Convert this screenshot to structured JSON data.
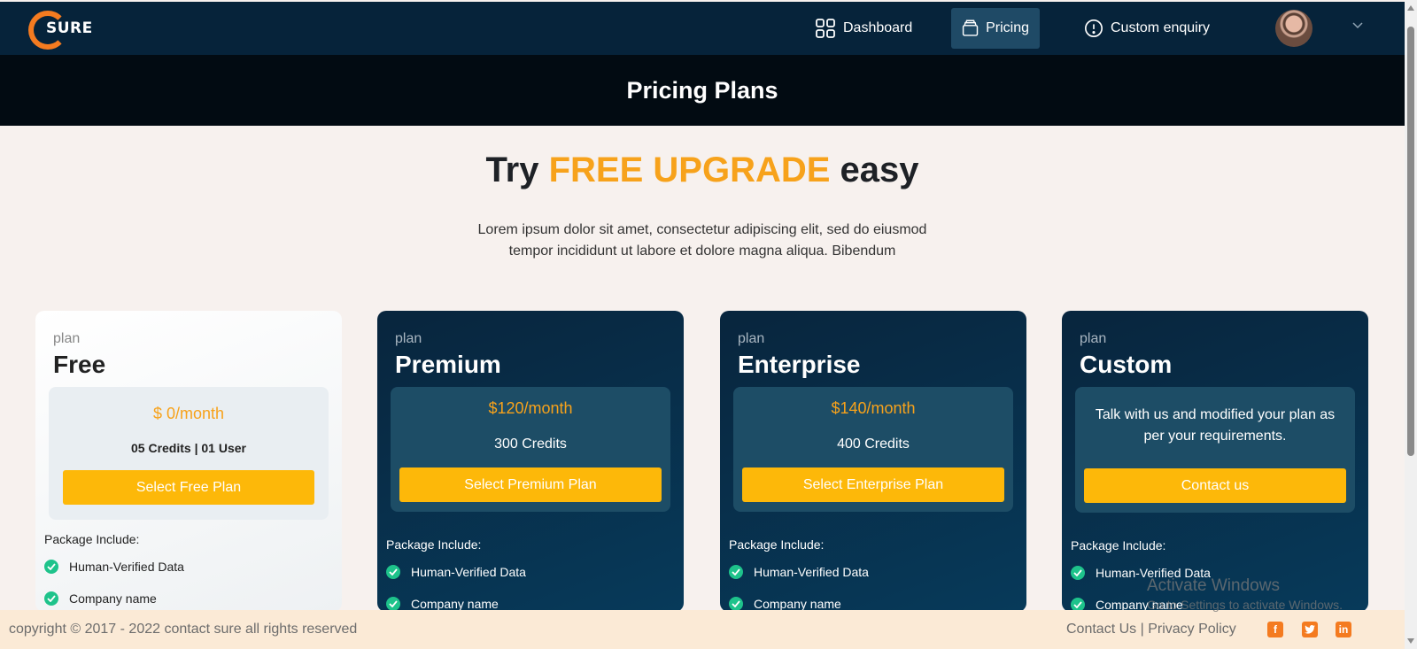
{
  "nav": {
    "logo_text": "SURE",
    "items": [
      {
        "label": "Dashboard",
        "icon": "grid-icon"
      },
      {
        "label": "Pricing",
        "icon": "cards-icon"
      },
      {
        "label": "Custom enquiry",
        "icon": "info-circle-icon"
      }
    ]
  },
  "band_title": "Pricing Plans",
  "hero": {
    "title_prefix": "Try ",
    "title_accent": "FREE UPGRADE",
    "title_suffix": " easy",
    "subtitle": "Lorem ipsum dolor sit amet, consectetur adipiscing elit, sed do eiusmod tempor incididunt ut labore et dolore magna aliqua. Bibendum"
  },
  "cards": [
    {
      "plan_label": "plan",
      "name": "Free",
      "price": "$ 0/month",
      "credits": "05 Credits | 01 User",
      "button": "Select Free Plan",
      "package_label": "Package Include:",
      "features": [
        "Human-Verified Data",
        "Company name"
      ]
    },
    {
      "plan_label": "plan",
      "name": "Premium",
      "price": "$120/month",
      "credits": "300 Credits",
      "button": "Select Premium Plan",
      "package_label": "Package Include:",
      "features": [
        "Human-Verified Data",
        "Company name"
      ]
    },
    {
      "plan_label": "plan",
      "name": "Enterprise",
      "price": "$140/month",
      "credits": "400 Credits",
      "button": "Select Enterprise Plan",
      "package_label": "Package Include:",
      "features": [
        "Human-Verified Data",
        "Company name"
      ]
    },
    {
      "plan_label": "plan",
      "name": "Custom",
      "description": "Talk with us and modified your plan as per your requirements.",
      "button": "Contact us",
      "package_label": "Package Include:",
      "features": [
        "Human-Verified Data",
        "Company name"
      ]
    }
  ],
  "footer": {
    "copyright": "copyright © 2017 - 2022 contact sure all rights reserved",
    "contact": "Contact Us",
    "separator": " | ",
    "privacy": "Privacy Policy",
    "social": [
      "facebook-icon",
      "twitter-icon",
      "linkedin-icon"
    ]
  },
  "watermark": {
    "line1": "Activate Windows",
    "line2": "Go to Settings to activate Windows."
  },
  "colors": {
    "nav_bg": "#06233a",
    "accent_orange": "#f7a21b",
    "button_yellow": "#fdb809",
    "card_dark": "#08253d",
    "check_green": "#1ec38b"
  }
}
